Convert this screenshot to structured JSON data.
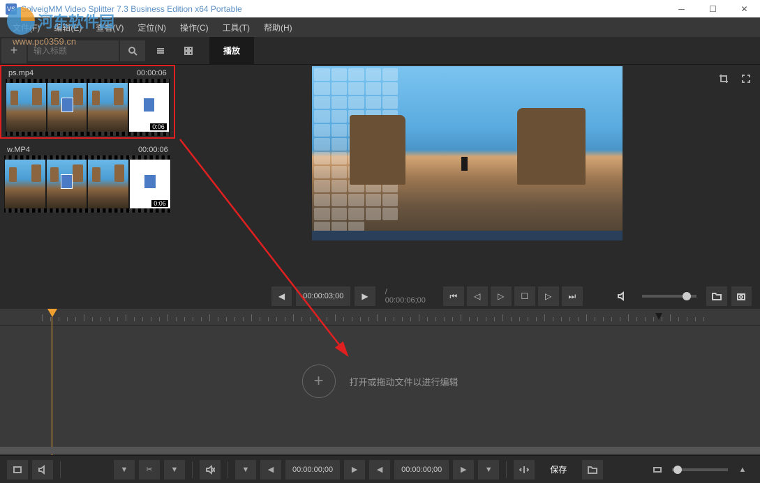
{
  "titlebar": {
    "icon_text": "VS",
    "title": "SolveigMM Video Splitter 7.3 Business Edition x64 Portable"
  },
  "menu": {
    "file": "文件(F)",
    "edit": "编辑(E)",
    "view": "查看(V)",
    "navigate": "定位(N)",
    "control": "操作(C)",
    "tools": "工具(T)",
    "help": "帮助(H)"
  },
  "toolbar": {
    "title_placeholder": "输入标题",
    "play_tab": "播放"
  },
  "clips": [
    {
      "name": "ps.mp4",
      "duration": "00:00:06",
      "frame_time": "0:06",
      "selected": true
    },
    {
      "name": "w.MP4",
      "duration": "00:00:06",
      "frame_time": "0:06",
      "selected": false
    }
  ],
  "playback": {
    "current_time": "00:00:03;00",
    "total_time": "/ 00:00:06;00"
  },
  "timeline": {
    "drop_hint": "打开或拖动文件以进行编辑"
  },
  "bottom": {
    "time1": "00:00:00;00",
    "time2": "00:00:00;00",
    "save_label": "保存"
  },
  "watermark": {
    "text": "河东软件园",
    "url": "www.pc0359.cn"
  }
}
